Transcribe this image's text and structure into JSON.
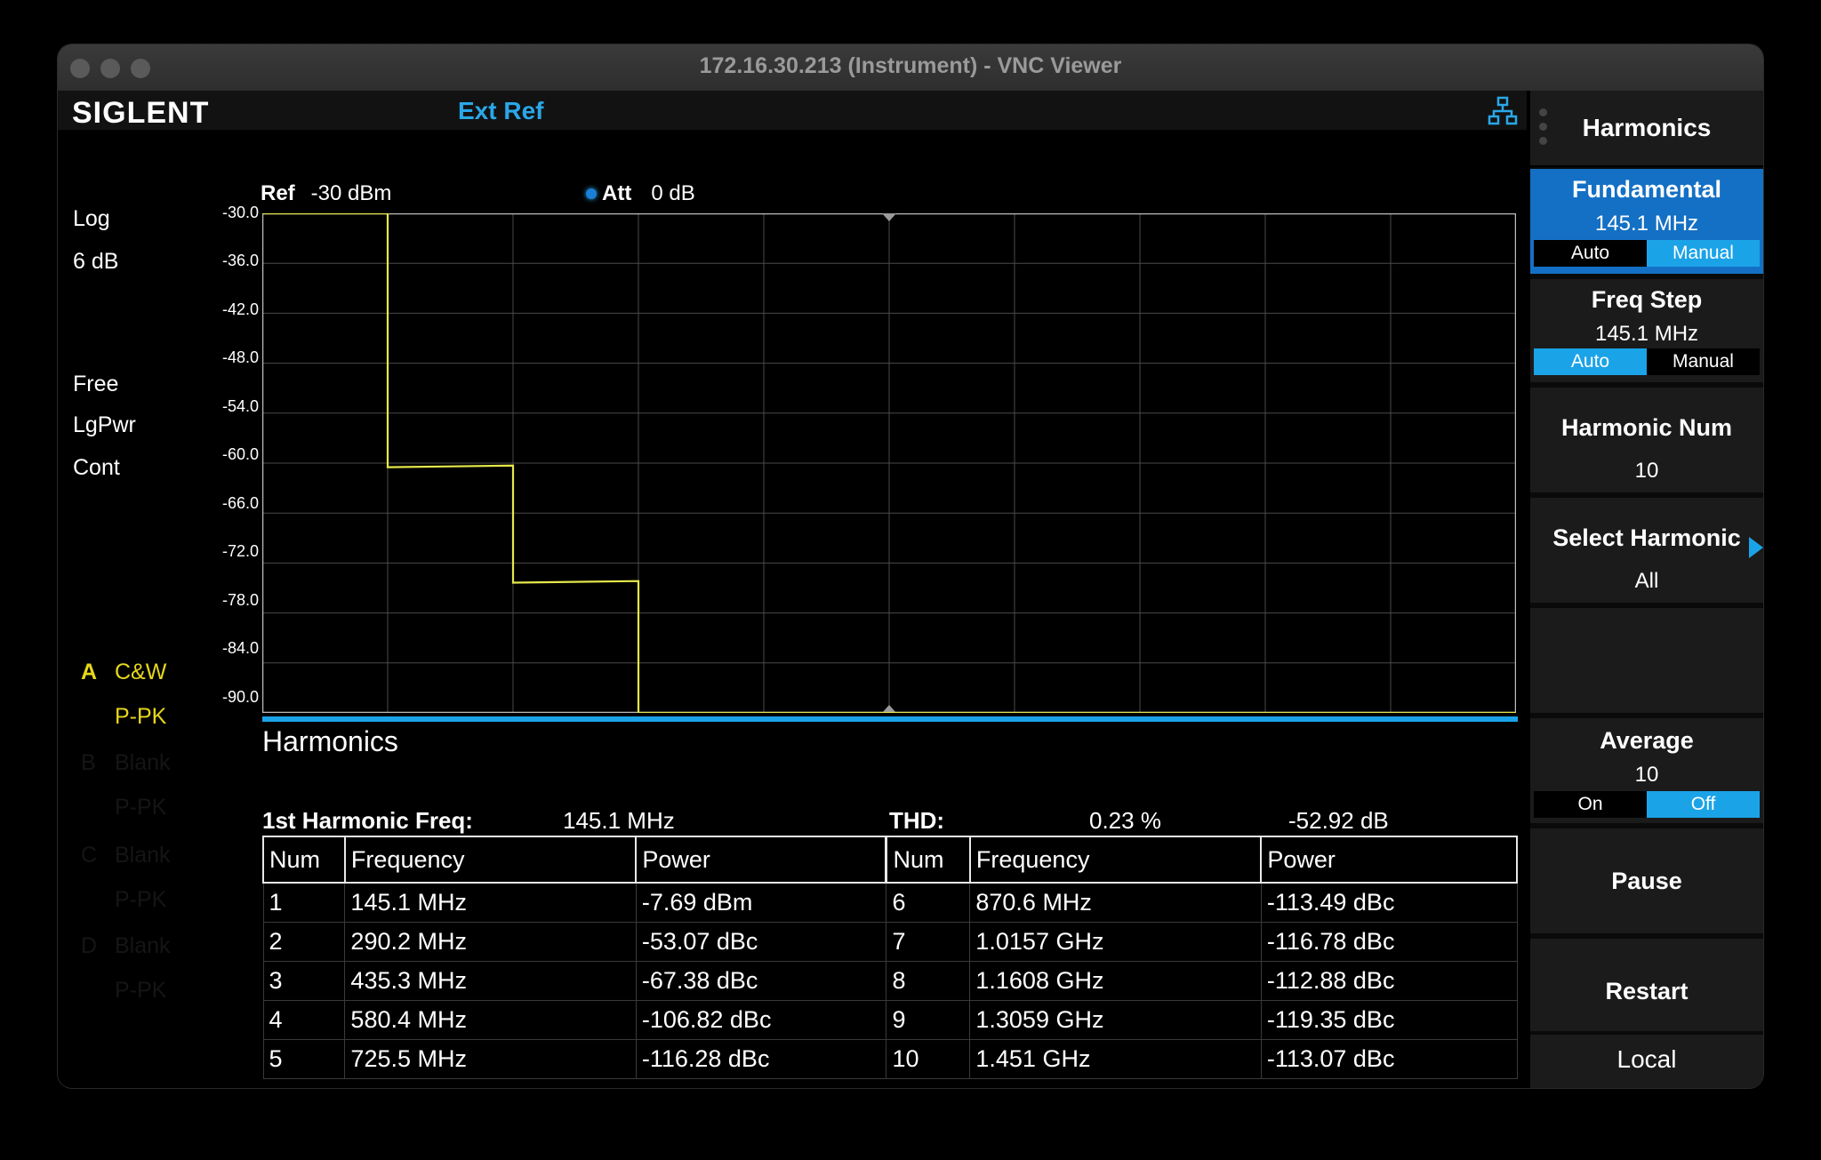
{
  "window": {
    "title": "172.16.30.213 (Instrument) - VNC Viewer"
  },
  "topbar": {
    "brand": "SIGLENT",
    "ext_ref": "Ext Ref"
  },
  "left_panel": {
    "scale_type": "Log",
    "scale_div": "6 dB",
    "trigger": "Free",
    "avg_type": "LgPwr",
    "sweep": "Cont",
    "traces": [
      {
        "letter": "A",
        "mode": "C&W",
        "detector": "P-PK"
      },
      {
        "letter": "B",
        "mode": "Blank",
        "detector": "P-PK"
      },
      {
        "letter": "C",
        "mode": "Blank",
        "detector": "P-PK"
      },
      {
        "letter": "D",
        "mode": "Blank",
        "detector": "P-PK"
      }
    ]
  },
  "plot_header": {
    "ref_label": "Ref",
    "ref_value": "-30 dBm",
    "att_label": "Att",
    "att_value": "0 dB"
  },
  "chart_data": {
    "type": "line",
    "xlabel": "",
    "ylabel": "",
    "y_ticks": [
      "-30.0",
      "-36.0",
      "-42.0",
      "-48.0",
      "-54.0",
      "-60.0",
      "-66.0",
      "-72.0",
      "-78.0",
      "-84.0",
      "-90.0"
    ],
    "ylim": [
      -91.0,
      -30.0
    ],
    "xlim": [
      0,
      10
    ],
    "grid": true,
    "series": [
      {
        "color": "#e6e84a",
        "x": [
          0,
          1.0,
          1.0,
          2.0,
          2.0,
          3.0,
          3.0,
          10
        ],
        "y": [
          -30.0,
          -30.0,
          -61.0,
          -60.8,
          -75.1,
          -74.9,
          -91.0,
          -91.0
        ]
      }
    ]
  },
  "results": {
    "title": "Harmonics",
    "first_harmonic_label": "1st Harmonic Freq:",
    "first_harmonic_value": "145.1 MHz",
    "thd_label": "THD:",
    "thd_percent": "0.23 %",
    "thd_db": "-52.92 dB",
    "headers": [
      "Num",
      "Frequency",
      "Power",
      "Num",
      "Frequency",
      "Power"
    ],
    "rows": [
      [
        "1",
        "145.1 MHz",
        "-7.69 dBm",
        "6",
        "870.6 MHz",
        "-113.49 dBc"
      ],
      [
        "2",
        "290.2 MHz",
        "-53.07 dBc",
        "7",
        "1.0157 GHz",
        "-116.78 dBc"
      ],
      [
        "3",
        "435.3 MHz",
        "-67.38 dBc",
        "8",
        "1.1608 GHz",
        "-112.88 dBc"
      ],
      [
        "4",
        "580.4 MHz",
        "-106.82 dBc",
        "9",
        "1.3059 GHz",
        "-119.35 dBc"
      ],
      [
        "5",
        "725.5 MHz",
        "-116.28 dBc",
        "10",
        "1.451 GHz",
        "-113.07 dBc"
      ]
    ]
  },
  "menu": {
    "title": "Harmonics",
    "fundamental": {
      "label": "Fundamental",
      "value": "145.1 MHz",
      "auto": "Auto",
      "manual": "Manual"
    },
    "freq_step": {
      "label": "Freq Step",
      "value": "145.1 MHz",
      "auto": "Auto",
      "manual": "Manual"
    },
    "harmonic_num": {
      "label": "Harmonic Num",
      "value": "10"
    },
    "select_harmonic": {
      "label": "Select Harmonic",
      "value": "All"
    },
    "average": {
      "label": "Average",
      "value": "10",
      "on": "On",
      "off": "Off"
    },
    "pause": "Pause",
    "restart": "Restart",
    "local": "Local"
  },
  "colors": {
    "accent": "#1ba3e8",
    "trace": "#e6e84a",
    "active_menu": "#1470c4"
  }
}
